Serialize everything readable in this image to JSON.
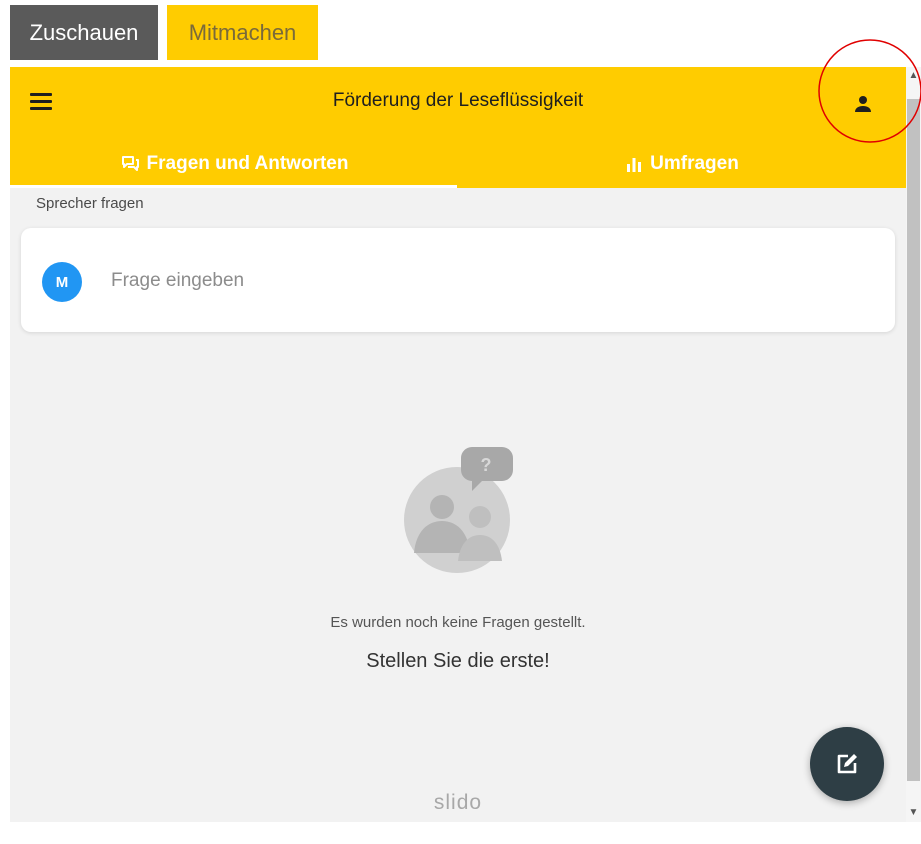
{
  "top_tabs": {
    "watch_label": "Zuschauen",
    "participate_label": "Mitmachen"
  },
  "header": {
    "title": "Förderung der Leseflüssigkeit",
    "menu_icon": "hamburger-menu-icon",
    "user_icon": "user-icon"
  },
  "tabs": [
    {
      "label": "Fragen und Antworten",
      "icon": "chat-icon",
      "active": true
    },
    {
      "label": "Umfragen",
      "icon": "bar-chart-icon",
      "active": false
    }
  ],
  "qa": {
    "section_label": "Sprecher fragen",
    "avatar_initial": "M",
    "input_placeholder": "Frage eingeben",
    "empty_message": "Es wurden noch keine Fragen gestellt.",
    "empty_cta": "Stellen Sie die erste!"
  },
  "brand": "slido",
  "fab_icon": "compose-icon",
  "colors": {
    "accent": "#ffcc00",
    "avatar": "#2196f3",
    "fab": "#2e3e45",
    "watch_button": "#5a5a5a",
    "highlight": "#e00000"
  }
}
